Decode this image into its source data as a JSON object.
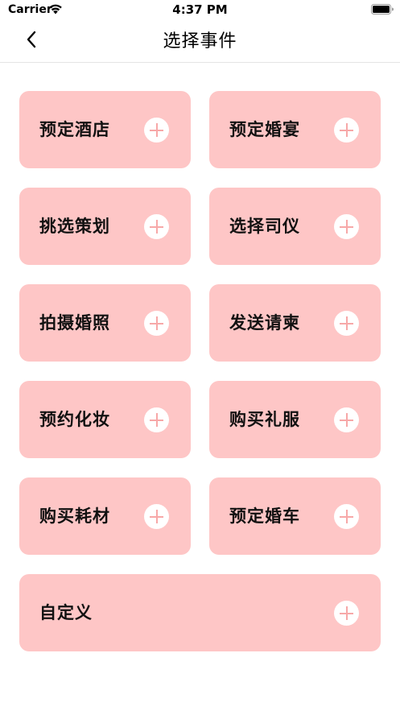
{
  "status_bar": {
    "carrier": "Carrier",
    "time": "4:37 PM"
  },
  "nav": {
    "title": "选择事件"
  },
  "events": [
    {
      "label": "预定酒店"
    },
    {
      "label": "预定婚宴"
    },
    {
      "label": "挑选策划"
    },
    {
      "label": "选择司仪"
    },
    {
      "label": "拍摄婚照"
    },
    {
      "label": "发送请柬"
    },
    {
      "label": "预约化妆"
    },
    {
      "label": "购买礼服"
    },
    {
      "label": "购买耗材"
    },
    {
      "label": "预定婚车"
    },
    {
      "label": "自定义"
    }
  ],
  "colors": {
    "card_bg": "#fec6c6",
    "plus_stroke": "#f7a8a8"
  }
}
